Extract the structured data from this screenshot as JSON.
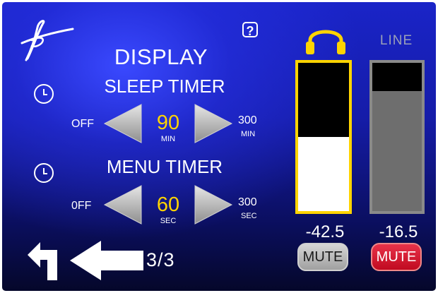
{
  "header": {
    "title": "DISPLAY",
    "help_glyph": "?",
    "logo_icon": "signature-logo"
  },
  "sleep_timer": {
    "label": "SLEEP TIMER",
    "min_label": "OFF",
    "max_label": "300",
    "max_unit": "MIN",
    "value": "90",
    "unit": "MIN"
  },
  "menu_timer": {
    "label": "MENU TIMER",
    "min_label": "0FF",
    "max_label": "300",
    "max_unit": "SEC",
    "value": "60",
    "unit": "SEC"
  },
  "meters": {
    "headphone": {
      "icon": "headphones-icon",
      "level_db": "-42.5",
      "fill_fraction": 0.5,
      "mute_label": "MUTE",
      "muted": false
    },
    "line": {
      "label": "LINE",
      "level_db": "-16.5",
      "fill_fraction": 0.81,
      "mute_label": "MUTE",
      "muted": true
    }
  },
  "navigation": {
    "page_indicator": "3/3",
    "back_icon": "return-arrow-icon",
    "prev_icon": "left-arrow-icon"
  },
  "colors": {
    "accent_yellow": "#ffd400",
    "mute_active": "#d8102a",
    "mute_inactive": "#a8a8a8",
    "meter_white": "#ffffff",
    "meter_gray": "#6e6e6e"
  }
}
